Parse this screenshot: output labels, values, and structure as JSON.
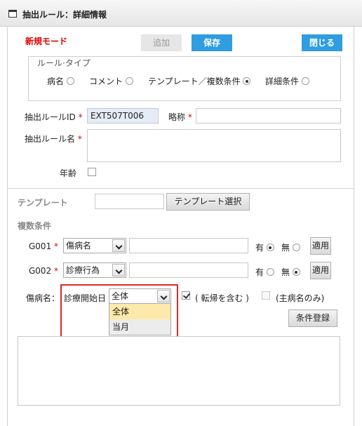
{
  "window": {
    "title": "抽出ルール：詳細情報"
  },
  "mode_label": "新規モード",
  "toolbar": {
    "add_label": "追加",
    "save_label": "保存",
    "close_label": "閉じる"
  },
  "rule_type": {
    "legend": "ルール·タイプ",
    "options": [
      {
        "label": "病名",
        "checked": false
      },
      {
        "label": "コメント",
        "checked": false
      },
      {
        "label": "テンプレート／複数条件",
        "checked": true
      },
      {
        "label": "詳細条件",
        "checked": false
      }
    ]
  },
  "rule_id": {
    "label": "抽出ルールID",
    "value": "EXT507T006"
  },
  "short_name": {
    "label": "略称",
    "value": ""
  },
  "rule_name": {
    "label": "抽出ルール名",
    "value": ""
  },
  "age": {
    "label": "年齢"
  },
  "template": {
    "label": "テンプレート",
    "value": "",
    "select_button": "テンプレート選択"
  },
  "multi_cond": {
    "label": "複数条件",
    "rows": [
      {
        "id": "G001",
        "select": "傷病名",
        "value": "",
        "yes_label": "有",
        "no_label": "無",
        "selected": "yes",
        "apply_label": "適用"
      },
      {
        "id": "G002",
        "select": "診療行為",
        "value": "",
        "yes_label": "有",
        "no_label": "無",
        "selected": "no",
        "apply_label": "適用"
      }
    ]
  },
  "disease": {
    "label": "傷病名：",
    "date_label": "診療開始日",
    "select_value": "全体",
    "dropdown_options": [
      "全体",
      "当月"
    ],
    "include_transfer": "( 転帰を含む )",
    "main_only": "(主病名のみ)",
    "register_button": "条件登録"
  }
}
